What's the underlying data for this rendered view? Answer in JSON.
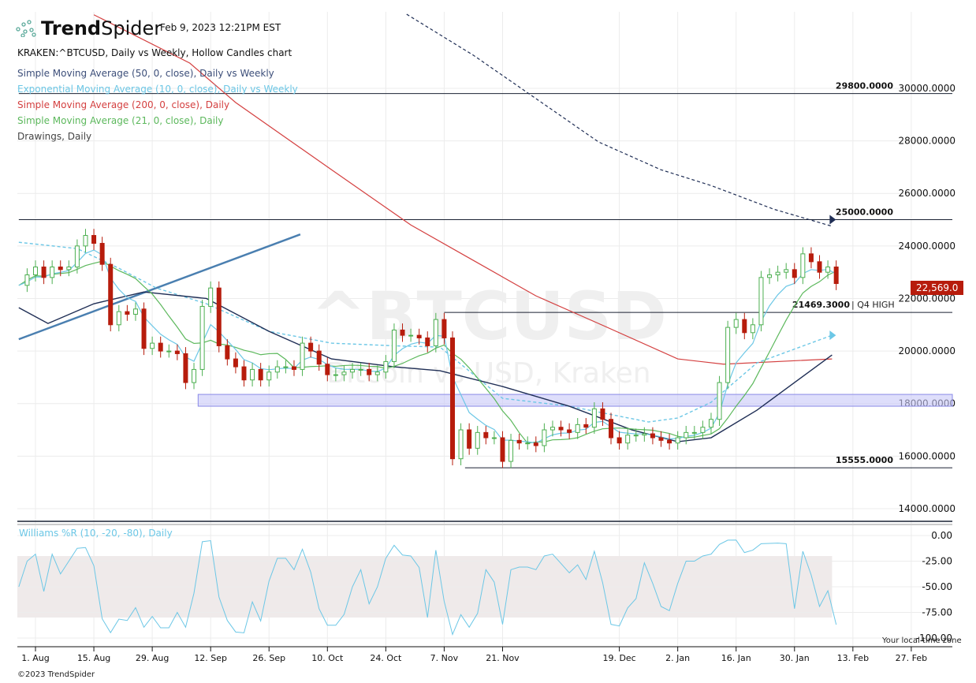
{
  "header": {
    "brand_bold": "Trend",
    "brand_light": "Spider",
    "timestamp": "Feb 9, 2023 12:21PM EST",
    "title": "KRAKEN:^BTCUSD, Daily vs Weekly, Hollow Candles chart",
    "legend": [
      {
        "label": "Simple Moving Average (50, 0, close), Daily vs Weekly",
        "color": "#3d4f7a"
      },
      {
        "label": "Exponential Moving Average (10, 0, close), Daily vs Weekly",
        "color": "#6cc7e6"
      },
      {
        "label": "Simple Moving Average (200, 0, close), Daily",
        "color": "#d44040"
      },
      {
        "label": "Simple Moving Average (21, 0, close), Daily",
        "color": "#5cb85c"
      },
      {
        "label": "Drawings, Daily",
        "color": "#444444"
      }
    ]
  },
  "watermark": {
    "symbol": "^BTCUSD",
    "name": "Bitcoin vs USD, Kraken"
  },
  "last_price": "22,569.0",
  "footer": {
    "copyright": "©2023 TrendSpider",
    "timezone": "Your local time zone"
  },
  "colors": {
    "up": "#4caf50",
    "down": "#b71c0c",
    "sma200": "#d44040",
    "sma50": "#1f2e55",
    "ema10": "#6cc7e6",
    "sma21": "#5cb85c",
    "wr": "#6cc7e6",
    "zone": "#c8c8f8"
  },
  "chart_data": {
    "type": "candlestick",
    "x_start_date": "2022-07-28",
    "x_step_days": 2,
    "x_tick_labels": [
      [
        "1. Aug",
        0
      ],
      [
        "15. Aug",
        14
      ],
      [
        "29. Aug",
        28
      ],
      [
        "12. Sep",
        42
      ],
      [
        "26. Sep",
        56
      ],
      [
        "10. Oct",
        70
      ],
      [
        "24. Oct",
        84
      ],
      [
        "7. Nov",
        98
      ],
      [
        "21. Nov",
        112
      ],
      [
        "19. Dec",
        140
      ],
      [
        "2. Jan",
        154
      ],
      [
        "16. Jan",
        168
      ],
      [
        "30. Jan",
        182
      ],
      [
        "13. Feb",
        196
      ],
      [
        "27. Feb",
        210
      ]
    ],
    "price_axis": {
      "ylim": [
        13600,
        31000
      ],
      "ticks": [
        "30000.0000",
        "28000.0000",
        "26000.0000",
        "24000.0000",
        "22000.0000",
        "20000.0000",
        "18000.0000",
        "16000.0000",
        "14000.0000"
      ],
      "tick_values": [
        30000,
        28000,
        26000,
        24000,
        22000,
        20000,
        18000,
        16000,
        14000
      ]
    },
    "closes": [
      22500,
      22900,
      23200,
      22800,
      23200,
      23100,
      23200,
      24000,
      24400,
      24100,
      23300,
      21000,
      21500,
      21400,
      21600,
      20100,
      20300,
      20000,
      20000,
      19900,
      18800,
      19300,
      21700,
      22400,
      20200,
      19700,
      19400,
      18900,
      19300,
      18900,
      19200,
      19400,
      19400,
      19300,
      20300,
      20000,
      19500,
      19100,
      19100,
      19200,
      19300,
      19300,
      19100,
      19200,
      19600,
      20800,
      20600,
      20600,
      20500,
      20200,
      21200,
      20500,
      15900,
      17000,
      16300,
      16900,
      16700,
      16700,
      15800,
      16600,
      16500,
      16500,
      16400,
      17000,
      17100,
      17000,
      16900,
      17200,
      17100,
      17800,
      17400,
      16700,
      16500,
      16800,
      16800,
      16850,
      16700,
      16600,
      16500,
      16700,
      16900,
      16900,
      17100,
      17400,
      18800,
      20900,
      21200,
      20700,
      21000,
      22800,
      22900,
      23000,
      23100,
      22800,
      23700,
      23400,
      23000,
      23200,
      22569
    ],
    "series": [
      {
        "name": "SMA 200 Daily",
        "points": [
          [
            14,
            32800
          ],
          [
            37,
            30960
          ],
          [
            48,
            29460
          ],
          [
            71,
            26900
          ],
          [
            90,
            24800
          ],
          [
            105,
            23450
          ],
          [
            120,
            22100
          ],
          [
            135,
            21050
          ],
          [
            154,
            19700
          ],
          [
            165,
            19500
          ],
          [
            191,
            19700
          ]
        ]
      },
      {
        "name": "SMA 50 Weekly",
        "points": [
          [
            89,
            32820
          ],
          [
            105,
            31260
          ],
          [
            120,
            29610
          ],
          [
            135,
            27960
          ],
          [
            150,
            26900
          ],
          [
            162,
            26300
          ],
          [
            177,
            25400
          ],
          [
            191,
            24750
          ]
        ]
      },
      {
        "name": "EMA 10 Weekly",
        "points": [
          [
            -4,
            24140
          ],
          [
            10,
            23900
          ],
          [
            20,
            23150
          ],
          [
            29,
            22400
          ],
          [
            41,
            21800
          ],
          [
            56,
            20750
          ],
          [
            71,
            20300
          ],
          [
            86,
            20200
          ],
          [
            97,
            20150
          ],
          [
            112,
            18200
          ],
          [
            128,
            17900
          ],
          [
            147,
            17300
          ],
          [
            154,
            17450
          ],
          [
            162,
            18050
          ],
          [
            173,
            19550
          ],
          [
            191,
            20600
          ]
        ]
      },
      {
        "name": "SMA 50 Daily",
        "points": [
          [
            -4,
            21650
          ],
          [
            3,
            21050
          ],
          [
            14,
            21800
          ],
          [
            26,
            22250
          ],
          [
            41,
            22000
          ],
          [
            56,
            20750
          ],
          [
            71,
            19700
          ],
          [
            86,
            19400
          ],
          [
            97,
            19250
          ],
          [
            112,
            18650
          ],
          [
            128,
            17900
          ],
          [
            143,
            17000
          ],
          [
            154,
            16550
          ],
          [
            162,
            16700
          ],
          [
            173,
            17750
          ],
          [
            191,
            19850
          ]
        ]
      }
    ],
    "drawings": [
      {
        "type": "hline",
        "value": 29800,
        "label": "29800.0000",
        "from_day": -4
      },
      {
        "type": "hline",
        "value": 25000,
        "label": "25000.0000",
        "from_day": -4
      },
      {
        "type": "hline",
        "value": 21469.3,
        "label": "21469.3000",
        "note": "| Q4 HIGH",
        "from_day": 98
      },
      {
        "type": "hline",
        "value": 15555,
        "label": "15555.0000",
        "from_day": 103
      },
      {
        "type": "zone",
        "low": 17900,
        "high": 18350,
        "from_day": 39
      },
      {
        "type": "trendline",
        "from": [
          -4,
          20450
        ],
        "to": [
          63.5,
          24440
        ]
      }
    ],
    "williams_r": {
      "title": "Williams %R (10, -20, -80), Daily",
      "ticks": [
        "0.00",
        "-25.00",
        "-50.00",
        "-75.00",
        "-100.00"
      ],
      "tick_values": [
        0,
        -25,
        -50,
        -75,
        -100
      ],
      "band": [
        -20,
        -80
      ],
      "period_points": 5
    }
  }
}
